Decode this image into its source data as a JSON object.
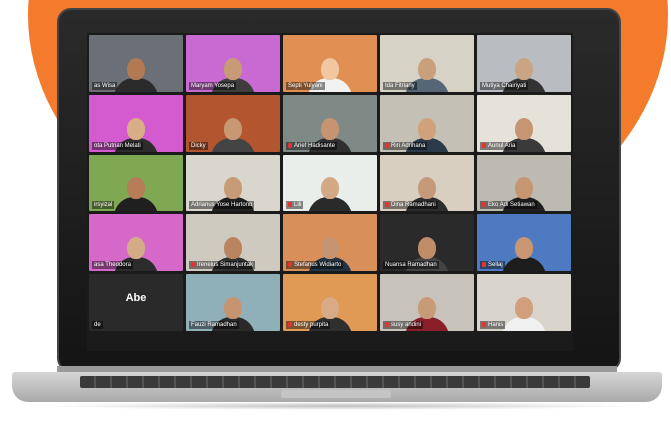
{
  "colors": {
    "accent": "#f47a2c",
    "mute": "#e33333"
  },
  "participants": [
    {
      "name": "as Wisa",
      "bg": "#6b6f76",
      "skin": "#b27a52",
      "shirt": "#2b2b2b",
      "muted": false
    },
    {
      "name": "Maryam Yosepa",
      "bg": "#c86ad1",
      "skin": "#c89a76",
      "shirt": "#3d3d3d",
      "muted": false
    },
    {
      "name": "Septi Yulyani",
      "bg": "#e18f53",
      "skin": "#f0c7a0",
      "shirt": "#f2f2f2",
      "muted": false
    },
    {
      "name": "Ida Fitriany",
      "bg": "#d6d2c6",
      "skin": "#c8a07c",
      "shirt": "#556677",
      "muted": false
    },
    {
      "name": "Mutiya Chairiyati",
      "bg": "#b9bcc1",
      "skin": "#c9a585",
      "shirt": "#333",
      "muted": false
    },
    {
      "name": "ota Putrian Melati",
      "bg": "#d45bcf",
      "skin": "#d9ad88",
      "shirt": "#2c2c2c",
      "muted": false
    },
    {
      "name": "Dicky",
      "bg": "#b3562f",
      "skin": "#c79873",
      "shirt": "#444",
      "muted": false
    },
    {
      "name": "Arief Hadisante",
      "bg": "#7f8a86",
      "skin": "#c69470",
      "shirt": "#2f2f2f",
      "muted": true
    },
    {
      "name": "Riri Adrihana",
      "bg": "#c5c0b6",
      "skin": "#d1a17b",
      "shirt": "#2a3a4a",
      "muted": true
    },
    {
      "name": "Aunul Aria",
      "bg": "#e5e2da",
      "skin": "#c79572",
      "shirt": "#3a3a3a",
      "muted": true
    },
    {
      "name": "irsyizal",
      "bg": "#7fa853",
      "skin": "#b57d58",
      "shirt": "#1f1f1f",
      "muted": false
    },
    {
      "name": "Adrianus Yose Hartono",
      "bg": "#d9d6ce",
      "skin": "#c89b78",
      "shirt": "#222",
      "muted": false
    },
    {
      "name": "Lili",
      "bg": "#e9eeea",
      "skin": "#d3a885",
      "shirt": "#2a2a2a",
      "muted": true
    },
    {
      "name": "Dina Ramadhani",
      "bg": "#d9cfc0",
      "skin": "#c49a7a",
      "shirt": "#2d2d2d",
      "muted": true
    },
    {
      "name": "Eko Adi Setiawan",
      "bg": "#bdbab2",
      "skin": "#c69671",
      "shirt": "#1f1f1f",
      "muted": true
    },
    {
      "name": "asa Theodora",
      "bg": "#d568c9",
      "skin": "#d4ab87",
      "shirt": "#2b2b2b",
      "muted": false
    },
    {
      "name": "Ireneius Simanjuntak",
      "bg": "#cfcac0",
      "skin": "#b9845f",
      "shirt": "#303030",
      "muted": true
    },
    {
      "name": "Stefanus Widiarto",
      "bg": "#d88f5a",
      "skin": "#c69470",
      "shirt": "#223344",
      "muted": true
    },
    {
      "name": "Nuansa Ramadhan",
      "bg": "#2a2a2a",
      "skin": "#c08d68",
      "shirt": "#444",
      "muted": false
    },
    {
      "name": "Sellaj",
      "bg": "#4d7ac0",
      "skin": "#c99773",
      "shirt": "#1d1d1d",
      "muted": true
    },
    {
      "name": "de",
      "bg": "#2a2a2a",
      "skin": "",
      "shirt": "",
      "muted": false,
      "avatar": "Abe"
    },
    {
      "name": "Fauzi Ramadhan",
      "bg": "#8fb0b9",
      "skin": "#c79470",
      "shirt": "#2a2a2a",
      "muted": false
    },
    {
      "name": "desty purpita",
      "bg": "#e09a56",
      "skin": "#d8ab86",
      "shirt": "#2f2f2f",
      "muted": true
    },
    {
      "name": "susy andini",
      "bg": "#c8c3ba",
      "skin": "#c89b78",
      "shirt": "#8a1f2a",
      "muted": true
    },
    {
      "name": "Hanis",
      "bg": "#d9d5cc",
      "skin": "#d0a07c",
      "shirt": "#f0f0f0",
      "muted": true
    }
  ]
}
